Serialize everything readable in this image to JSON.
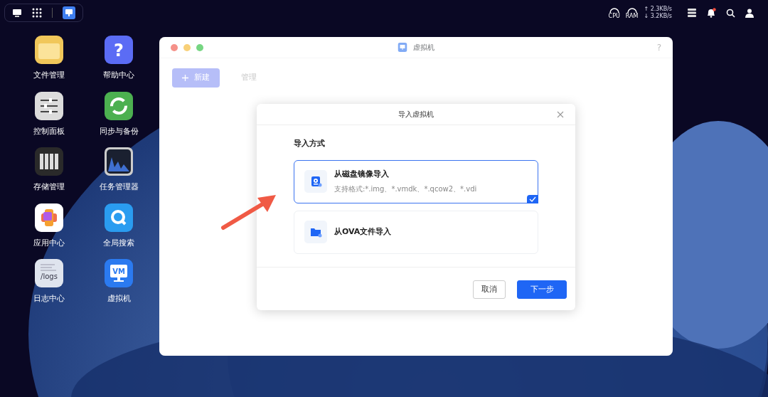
{
  "topbar": {
    "gauges": [
      "CPU",
      "RAM"
    ],
    "upload": "↑ 2.3KB/s",
    "download": "↓ 3.2KB/s",
    "notification": true
  },
  "desktop_icons": [
    {
      "kind": "folder",
      "label": "文件管理"
    },
    {
      "kind": "sliders",
      "label": "控制面板"
    },
    {
      "kind": "storage",
      "label": "存储管理"
    },
    {
      "kind": "apps",
      "label": "应用中心"
    },
    {
      "kind": "logs",
      "label": "日志中心",
      "text": "/logs"
    },
    {
      "kind": "help",
      "label": "帮助中心",
      "text": "?"
    },
    {
      "kind": "sync",
      "label": "同步与备份"
    },
    {
      "kind": "monitor",
      "label": "任务管理器"
    },
    {
      "kind": "search",
      "label": "全局搜索"
    },
    {
      "kind": "vm",
      "label": "虚拟机",
      "text": "VM"
    }
  ],
  "window": {
    "title": "虚拟机",
    "help": "?",
    "toolbar": [
      {
        "kind": "primary",
        "label": "新建",
        "disabled": true
      },
      {
        "kind": "text",
        "label": "管理",
        "disabled": true
      }
    ]
  },
  "dialog": {
    "title": "导入虚拟机",
    "section": "导入方式",
    "options": [
      {
        "kind": "disk",
        "title": "从磁盘镜像导入",
        "subtitle": "支持格式:*.img、*.vmdk、*.qcow2、*.vdi",
        "selected": true
      },
      {
        "kind": "ova",
        "title": "从OVA文件导入",
        "selected": false
      }
    ],
    "buttons": [
      {
        "kind": "secondary",
        "label": "取消"
      },
      {
        "kind": "primary",
        "label": "下一步"
      }
    ]
  }
}
